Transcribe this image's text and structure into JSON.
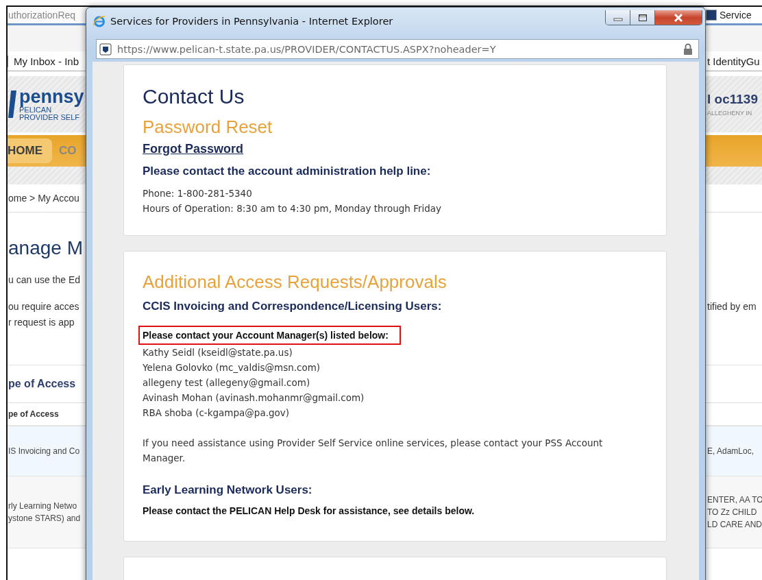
{
  "background_page": {
    "tab_title": "uthorizationReq",
    "right_tab": "Service",
    "favorites_left": "My Inbox - Inb",
    "favorites_right": "t IdentityGu",
    "logo": {
      "wordmark": "pennsy",
      "line_1": "PELICAN",
      "line_2": "PROVIDER SELF"
    },
    "user": {
      "name": "l oc1139",
      "org": "ALLEGHENY IN"
    },
    "nav": [
      {
        "label": "HOME",
        "selected": true
      },
      {
        "label": "CO",
        "selected": false
      }
    ],
    "breadcrumb": "ome > My Accou",
    "heading": "anage M",
    "intro": "u can use the Ed",
    "notice_left": [
      "ou require acces",
      "r request is app"
    ],
    "notice_right": "tified by em",
    "section_title": "pe of Access",
    "table": {
      "column_1": "pe of Access",
      "rows": [
        {
          "selected": true,
          "left": [
            "IS Invoicing and Co"
          ],
          "right": [
            "E, AdamLoc,"
          ]
        },
        {
          "selected": false,
          "left": [
            "rly Learning Netwo",
            "ystone STARS) and"
          ],
          "right": [
            "ENTER, AA TO",
            "TO Zz CHILD",
            "LD CARE AND"
          ]
        }
      ]
    }
  },
  "popup": {
    "title": "Services for Providers in Pennsylvania - Internet Explorer",
    "address": "https://www.pelican-t.state.pa.us/PROVIDER/CONTACTUS.ASPX?noheader=Y",
    "cards": [
      {
        "blocks": [
          {
            "kind": "page_title",
            "text": "Contact Us"
          },
          {
            "kind": "section_title",
            "text": "Password Reset"
          },
          {
            "kind": "link",
            "text": "Forgot Password"
          },
          {
            "kind": "label",
            "text": "Please contact the account administration help line:"
          },
          {
            "kind": "text",
            "text": "Phone: 1-800-281-5340"
          },
          {
            "kind": "text",
            "text": "Hours of Operation: 8:30 am to 4:30 pm, Monday through Friday"
          }
        ]
      },
      {
        "blocks": [
          {
            "kind": "section_title",
            "text": "Additional Access Requests/Approvals"
          },
          {
            "kind": "label",
            "text": "CCIS Invoicing and Correspondence/Licensing Users:"
          },
          {
            "kind": "note",
            "text": "Please contact your Account Manager(s) listed below:",
            "highlighted": true
          },
          {
            "kind": "text",
            "text": "Kathy Seidl (kseidl@state.pa.us)"
          },
          {
            "kind": "text",
            "text": "Yelena Golovko (mc_valdis@msn.com)"
          },
          {
            "kind": "text",
            "text": "allegeny test (allegeny@gmail.com)"
          },
          {
            "kind": "text",
            "text": "Avinash Mohan (avinash.mohanmr@gmail.com)"
          },
          {
            "kind": "text",
            "text": "RBA shoba (c-kgampa@pa.gov)"
          },
          {
            "kind": "paragraph",
            "text": "If you need assistance using Provider Self Service online services, please contact your PSS Account Manager."
          },
          {
            "kind": "label",
            "text": "Early Learning Network Users:"
          },
          {
            "kind": "note",
            "text": "Please contact the PELICAN Help Desk for assistance, see details below.",
            "highlighted": false
          }
        ]
      }
    ]
  }
}
